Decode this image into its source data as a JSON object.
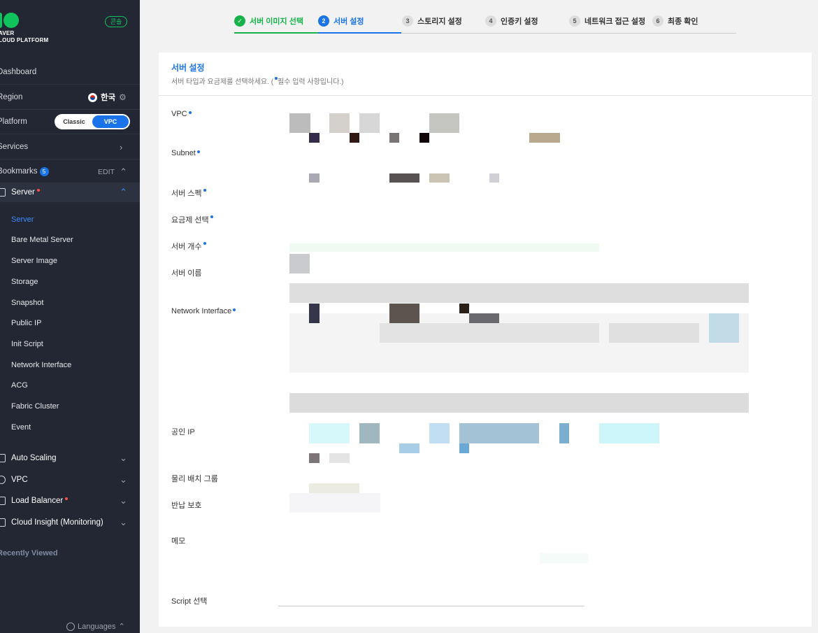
{
  "sidebar": {
    "logo_line1": "NAVER",
    "logo_line2": "CLOUD PLATFORM",
    "console_badge": "콘솔",
    "dashboard": "Dashboard",
    "region_label": "Region",
    "region_value": "한국",
    "platform_label": "Platform",
    "platform_options": [
      "Classic",
      "VPC"
    ],
    "platform_selected": "VPC",
    "services_label": "Services",
    "bookmarks_label": "Bookmarks",
    "bookmarks_count": "5",
    "bookmarks_edit": "EDIT",
    "server_group": "Server",
    "server_items": [
      "Server",
      "Bare Metal Server",
      "Server Image",
      "Storage",
      "Snapshot",
      "Public IP",
      "Init Script",
      "Network Interface",
      "ACG",
      "Fabric Cluster",
      "Event"
    ],
    "server_selected": "Server",
    "groups": [
      "Auto Scaling",
      "VPC",
      "Load Balancer",
      "Cloud Insight (Monitoring)"
    ],
    "recently_viewed": "Recently Viewed",
    "languages": "Languages"
  },
  "steps": [
    {
      "num": "✓",
      "label": "서버 이미지 선택",
      "state": "done"
    },
    {
      "num": "2",
      "label": "서버 설정",
      "state": "current"
    },
    {
      "num": "3",
      "label": "스토리지 설정",
      "state": "todo"
    },
    {
      "num": "4",
      "label": "인증키 설정",
      "state": "todo"
    },
    {
      "num": "5",
      "label": "네트워크 접근 설정",
      "state": "todo"
    },
    {
      "num": "6",
      "label": "최종 확인",
      "state": "todo"
    }
  ],
  "panel": {
    "title": "서버 설정",
    "desc_before": "서버 타입과 요금제를 선택하세요. (",
    "desc_after": "필수 입력 사항입니다.)",
    "fields": {
      "vpc": "VPC",
      "subnet": "Subnet",
      "spec": "서버 스펙",
      "pricing": "요금제 선택",
      "count": "서버 개수",
      "name": "서버 이름",
      "nic": "Network Interface",
      "public_ip": "공인 IP",
      "placement": "물리 배치 그룹",
      "protection": "반납 보호",
      "memo": "메모",
      "script": "Script 선택"
    }
  },
  "colors": {
    "sidebar_bg": "#232733",
    "accent_blue": "#1a73e8",
    "accent_green": "#17b34a",
    "brand_green": "#0fc45c"
  }
}
